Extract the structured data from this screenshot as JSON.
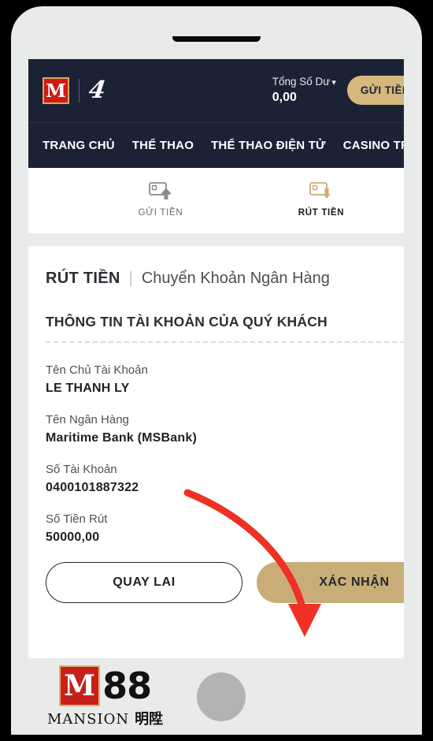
{
  "header": {
    "brand_mark": "M",
    "partner_mark": "4",
    "balance_label": "Tổng Số Dư",
    "balance_chevron": "chevron-down-icon",
    "balance_value": "0,00",
    "deposit_button": "GỬI TIỀN",
    "menu_icon": "hamburger-menu-icon",
    "bg_color": "#1c2235",
    "accent_gold": "#d4b87e"
  },
  "nav": {
    "items": [
      {
        "label": "TRANG CHỦ"
      },
      {
        "label": "THỂ THAO"
      },
      {
        "label": "THỂ THAO ĐIỆN TỬ"
      },
      {
        "label": "CASINO TRỰC T"
      }
    ]
  },
  "tabs": [
    {
      "label": "GỬI TIỀN",
      "icon": "deposit-card-up-arrow-icon",
      "active": false,
      "color": "#6b6b6b"
    },
    {
      "label": "RÚT TIỀN",
      "icon": "withdraw-card-down-arrow-icon",
      "active": true,
      "color": "#c9ad78"
    }
  ],
  "page": {
    "title_strong": "RÚT TIỀN",
    "title_separator": "|",
    "title_light": "Chuyển Khoản Ngân Hàng",
    "section_title": "THÔNG TIN TÀI KHOẢN CỦA QUÝ KHÁCH",
    "fields": [
      {
        "label": "Tên Chủ Tài Khoản",
        "value": "LE THANH LY"
      },
      {
        "label": "Tên Ngân Hàng",
        "value": "Maritime Bank (MSBank)"
      },
      {
        "label": "Số Tài Khoản",
        "value": "0400101887322"
      },
      {
        "label": "Số Tiền Rút",
        "value": "50000,00"
      }
    ],
    "buttons": {
      "back": "QUAY LAI",
      "confirm": "XÁC NHẬN"
    }
  },
  "annotation": {
    "arrow_color": "#ee3124",
    "arrow_target": "XÁC NHẬN"
  },
  "footer": {
    "brand_m": "M",
    "brand_88": "88",
    "brand_mansion": "MANSION",
    "brand_cjk": "明陞",
    "home_button": "home-button"
  }
}
